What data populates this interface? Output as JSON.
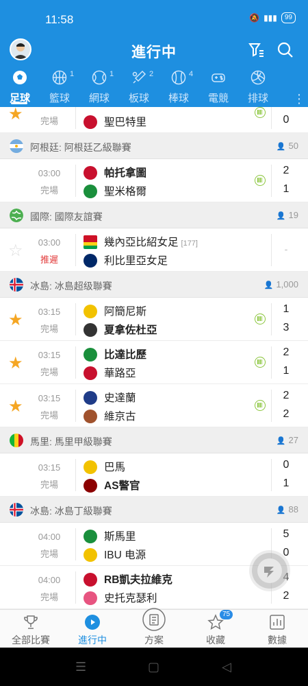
{
  "status": {
    "time": "11:58",
    "battery": "99"
  },
  "header": {
    "title": "進行中"
  },
  "sports": [
    {
      "label": "足球",
      "count": "",
      "icon": "soccer-ball-icon",
      "active": true
    },
    {
      "label": "籃球",
      "count": "1",
      "icon": "basketball-icon"
    },
    {
      "label": "網球",
      "count": "1",
      "icon": "tennis-ball-icon"
    },
    {
      "label": "板球",
      "count": "2",
      "icon": "cricket-icon"
    },
    {
      "label": "棒球",
      "count": "4",
      "icon": "baseball-icon"
    },
    {
      "label": "電競",
      "count": "",
      "icon": "gamepad-icon"
    },
    {
      "label": "排球",
      "count": "",
      "icon": "volleyball-icon"
    }
  ],
  "list": {
    "partial": {
      "team1": "",
      "team2": "聖巴特里",
      "state": "完場",
      "score1": "",
      "score2": "0"
    },
    "leagues": [
      {
        "name": "阿根廷: 阿根廷乙級聯賽",
        "count": "50",
        "flag": "argentina",
        "matches": [
          {
            "starred": false,
            "time": "03:00",
            "state": "完場",
            "team1": "帕托拿圖",
            "team2": "聖米格爾",
            "score1": "2",
            "score2": "1",
            "live": true,
            "logo1": "#c8102e",
            "logo2": "#1a8f3c"
          }
        ]
      },
      {
        "name": "國際: 國際友誼賽",
        "count": "19",
        "flag": "world",
        "matches": [
          {
            "starred": false,
            "time": "03:00",
            "state": "推遲",
            "team1": "幾內亞比紹女足",
            "rank": "[177]",
            "team2": "利比里亞女足",
            "score1": "",
            "score2": "",
            "dash": "-",
            "live": false,
            "logo1": "#ce1126",
            "logo2": "#002868"
          }
        ]
      },
      {
        "name": "冰島: 冰島超级聯賽",
        "count": "1,000",
        "flag": "iceland",
        "matches": [
          {
            "starred": true,
            "time": "03:15",
            "state": "完場",
            "team1": "阿簡尼斯",
            "team2": "夏拿佐杜亞",
            "score1": "1",
            "score2": "3",
            "live": true,
            "logo1": "#f2c200",
            "logo2": "#333333"
          },
          {
            "starred": true,
            "time": "03:15",
            "state": "完場",
            "team1": "比達比歷",
            "team2": "華路亞",
            "score1": "2",
            "score2": "1",
            "live": true,
            "logo1": "#1a8f3c",
            "logo2": "#c8102e"
          },
          {
            "starred": true,
            "time": "03:15",
            "state": "完場",
            "team1": "史達蘭",
            "team2": "維京古",
            "score1": "2",
            "score2": "2",
            "live": true,
            "logo1": "#1f3c88",
            "logo2": "#a0522d"
          }
        ]
      },
      {
        "name": "馬里: 馬里甲級聯賽",
        "count": "27",
        "flag": "mali",
        "matches": [
          {
            "starred": false,
            "time": "03:15",
            "state": "完場",
            "team1": "巴馬",
            "team2": "AS警官",
            "score1": "0",
            "score2": "1",
            "live": false,
            "logo1": "#f2c200",
            "logo2": "#8b0000"
          }
        ]
      },
      {
        "name": "冰島: 冰島丁級聯賽",
        "count": "88",
        "flag": "iceland",
        "matches": [
          {
            "starred": false,
            "time": "04:00",
            "state": "完場",
            "team1": "斯馬里",
            "team2": "IBU 电源",
            "score1": "5",
            "score2": "0",
            "live": false,
            "logo1": "#1a8f3c",
            "logo2": "#f2c200"
          },
          {
            "starred": false,
            "time": "04:00",
            "state": "完場",
            "team1": "RB凱夫拉維克",
            "team2": "史托克瑟利",
            "score1": "4",
            "score2": "2",
            "live": false,
            "logo1": "#c8102e",
            "logo2": "#e75480"
          }
        ]
      }
    ]
  },
  "bottom_nav": [
    {
      "label": "全部比賽",
      "icon": "trophy-icon"
    },
    {
      "label": "進行中",
      "icon": "play-circle-icon",
      "active": true
    },
    {
      "label": "方案",
      "icon": "document-icon"
    },
    {
      "label": "收藏",
      "icon": "star-icon",
      "badge": "75"
    },
    {
      "label": "數據",
      "icon": "bar-chart-icon"
    }
  ],
  "colors": {
    "primary": "#1e8fe0",
    "star": "#f5a623",
    "postponed": "#e23b3b"
  }
}
